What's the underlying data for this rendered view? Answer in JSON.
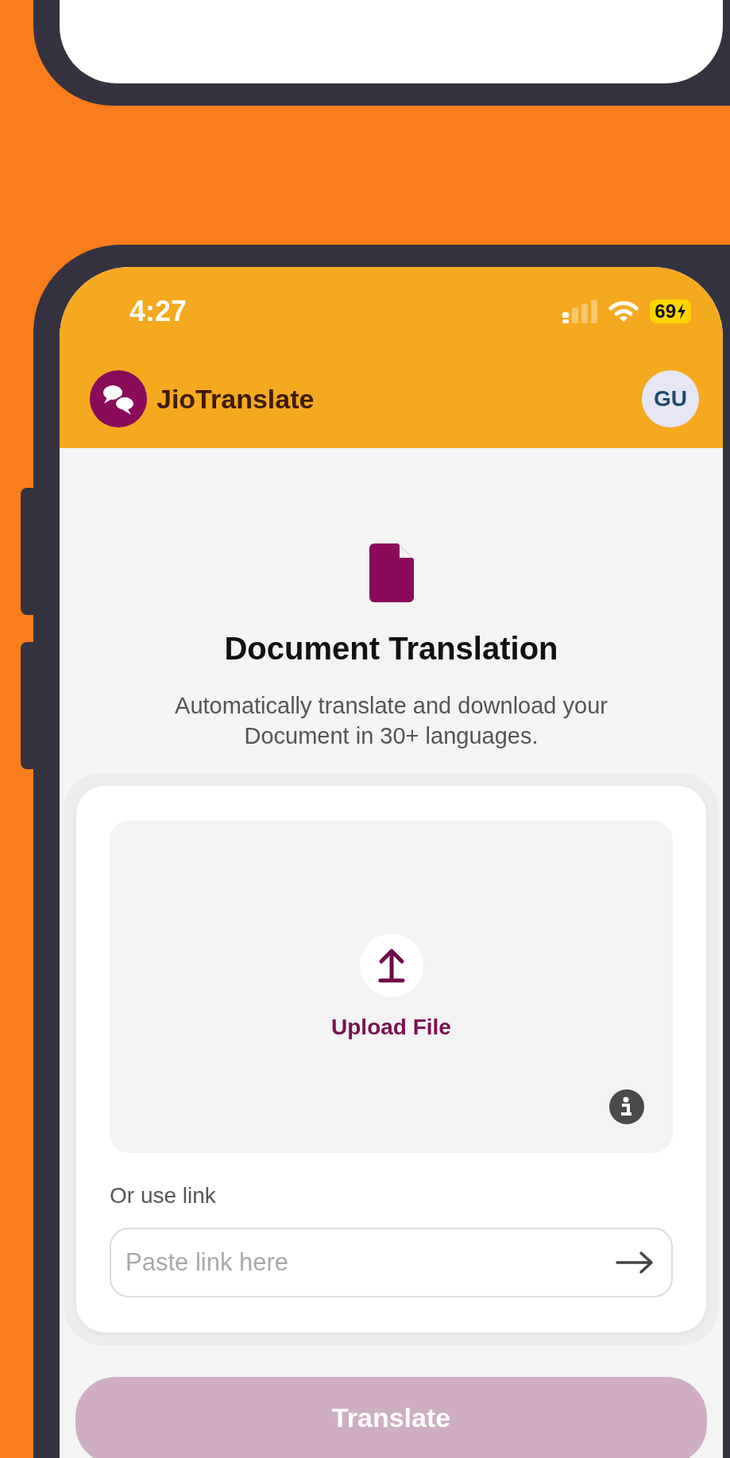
{
  "status_bar": {
    "time": "4:27",
    "battery": "69"
  },
  "app_bar": {
    "title": "JioTranslate",
    "avatar": "GU"
  },
  "intro": {
    "title": "Document Translation",
    "subtitle": "Automatically translate and download your Document in 30+ languages."
  },
  "upload": {
    "label": "Upload File"
  },
  "link": {
    "label": "Or use link",
    "placeholder": "Paste link here"
  },
  "translate_button": {
    "label": "Translate",
    "disabled": true
  }
}
